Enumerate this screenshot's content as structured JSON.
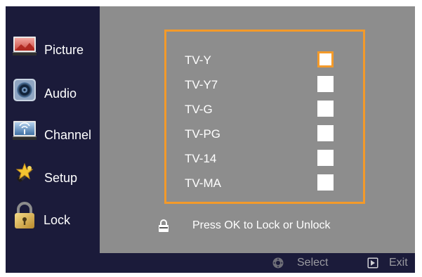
{
  "sidebar": {
    "items": [
      {
        "label": "Picture",
        "icon": "picture-icon"
      },
      {
        "label": "Audio",
        "icon": "audio-icon"
      },
      {
        "label": "Channel",
        "icon": "channel-icon"
      },
      {
        "label": "Setup",
        "icon": "setup-icon"
      },
      {
        "label": "Lock",
        "icon": "lock-icon",
        "selected": true
      }
    ]
  },
  "ratings": {
    "items": [
      {
        "label": "TV-Y",
        "locked": false,
        "focused": true
      },
      {
        "label": "TV-Y7",
        "locked": false
      },
      {
        "label": "TV-G",
        "locked": false
      },
      {
        "label": "TV-PG",
        "locked": false
      },
      {
        "label": "TV-14",
        "locked": false
      },
      {
        "label": "TV-MA",
        "locked": false
      }
    ]
  },
  "hint": {
    "text": "Press OK to Lock or Unlock",
    "icon": "padlock-icon"
  },
  "footer": {
    "select_label": "Select",
    "select_icon": "dpad-icon",
    "exit_label": "Exit",
    "exit_icon": "exit-icon"
  },
  "colors": {
    "accent": "#f39a2a",
    "sidebar_bg": "#1b1b3a",
    "content_bg": "#8d8d8d",
    "footer_text": "#9a9aa0"
  }
}
